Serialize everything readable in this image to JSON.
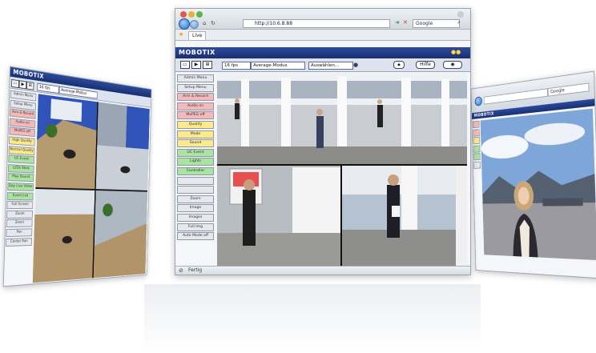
{
  "main_window": {
    "url": "http://10.6.8.88",
    "search_placeholder": "Google",
    "tab_label": "Live",
    "brand": "MOBOTIX",
    "toolbar": {
      "fps_select": "16 fps",
      "mode_select": "Average-Modus",
      "display_select": "Auswählen...",
      "help_button": "Hilfe"
    },
    "menu_items": [
      {
        "label": "Admin Menu",
        "color": "#e6e8ee"
      },
      {
        "label": "Setup Menu",
        "color": "#e6e8ee"
      },
      {
        "label": "Arm & Record",
        "color": "#f4b9b9"
      },
      {
        "label": "Audio on",
        "color": "#f4b9b9"
      },
      {
        "label": "MxPEG off",
        "color": "#f4b9b9"
      },
      {
        "label": "Quality",
        "color": "#fbe98c"
      },
      {
        "label": "Mode",
        "color": "#fbe98c"
      },
      {
        "label": "Sound",
        "color": "#fbe98c"
      },
      {
        "label": "UC Event",
        "color": "#a9e4a0"
      },
      {
        "label": "Lights",
        "color": "#a9e4a0"
      },
      {
        "label": "Controller",
        "color": "#a9e4a0"
      },
      {
        "label": "",
        "color": "#e6e8ee"
      },
      {
        "label": "",
        "color": "#e6e8ee"
      },
      {
        "label": "Zoom",
        "color": "#e6e8ee"
      },
      {
        "label": "Image",
        "color": "#e6e8ee"
      },
      {
        "label": "Images",
        "color": "#e6e8ee"
      },
      {
        "label": "Full Img",
        "color": "#e6e8ee"
      },
      {
        "label": "Auto Mode off",
        "color": "#e6e8ee"
      }
    ],
    "status_text": "Fertig"
  },
  "left_window": {
    "brand": "MOBOTIX",
    "fps_select": "16 fps",
    "mode_select": "Average-Modus",
    "menu_items": [
      {
        "label": "Admin Menu",
        "color": "#e6e8ee"
      },
      {
        "label": "Setup Menu",
        "color": "#e6e8ee"
      },
      {
        "label": "Arm & Record",
        "color": "#f4b9b9"
      },
      {
        "label": "Audio on",
        "color": "#f4b9b9"
      },
      {
        "label": "MxPEG off",
        "color": "#f4b9b9"
      },
      {
        "label": "High Quality",
        "color": "#fbe98c"
      },
      {
        "label": "Normal Quality",
        "color": "#fbe98c"
      },
      {
        "label": "UC Event",
        "color": "#a9e4a0"
      },
      {
        "label": "LEDs Blink",
        "color": "#a9e4a0"
      },
      {
        "label": "Play Sound",
        "color": "#a9e4a0"
      },
      {
        "label": "Day Live Video",
        "color": "#a9e4a0"
      },
      {
        "label": "Event List",
        "color": "#a9e4a0"
      },
      {
        "label": "Full Screen",
        "color": "#e6e8ee"
      },
      {
        "label": "Zoom",
        "color": "#e6e8ee"
      },
      {
        "label": "Zoom",
        "color": "#e6e8ee"
      },
      {
        "label": "Pan",
        "color": "#e6e8ee"
      },
      {
        "label": "Center Pan",
        "color": "#e6e8ee"
      }
    ]
  },
  "right_window": {
    "search_placeholder": "Google",
    "brand": "MOBOTIX"
  }
}
